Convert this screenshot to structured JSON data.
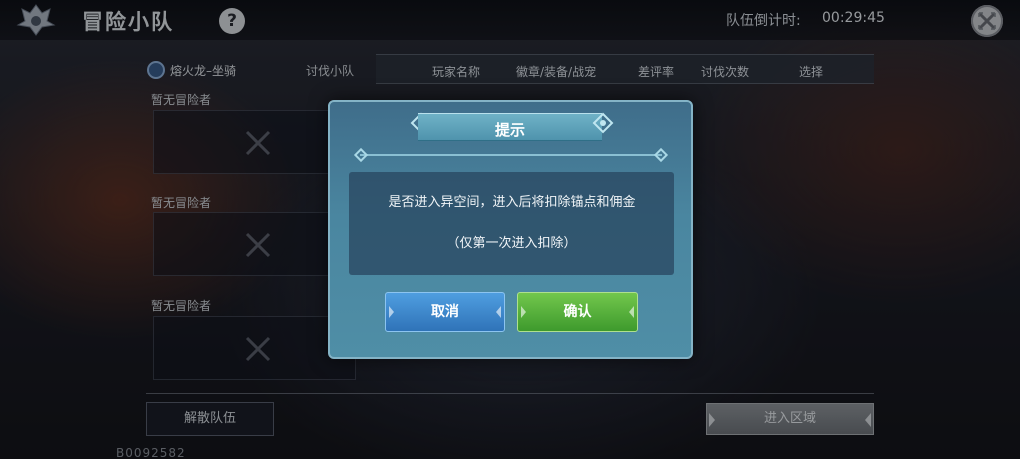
{
  "header": {
    "title": "冒险小队",
    "help_icon": "question-icon",
    "help_glyph": "?",
    "timer_label": "队伍倒计时:",
    "timer_value": "00:29:45",
    "close_icon": "close-icon"
  },
  "left_panel": {
    "mount_label": "熔火龙–坐骑",
    "subtab_label": "讨伐小队",
    "slots": [
      {
        "label": "暂无冒险者"
      },
      {
        "label": "暂无冒险者"
      },
      {
        "label": "暂无冒险者"
      }
    ]
  },
  "table": {
    "columns": [
      "玩家名称",
      "徽章/装备/战宠",
      "差评率",
      "讨伐次数",
      "选择"
    ]
  },
  "footer": {
    "disband_label": "解散队伍",
    "enter_label": "进入区域",
    "team_id": "B0092582"
  },
  "dialog": {
    "title": "提示",
    "message": "是否进入异空间，进入后将扣除锚点和佣金",
    "note": "（仅第一次进入扣除）",
    "cancel_label": "取消",
    "confirm_label": "确认"
  },
  "colors": {
    "confirm": "#4fae37",
    "cancel": "#3a86cc",
    "dialog_bg": "#4a86a0"
  }
}
